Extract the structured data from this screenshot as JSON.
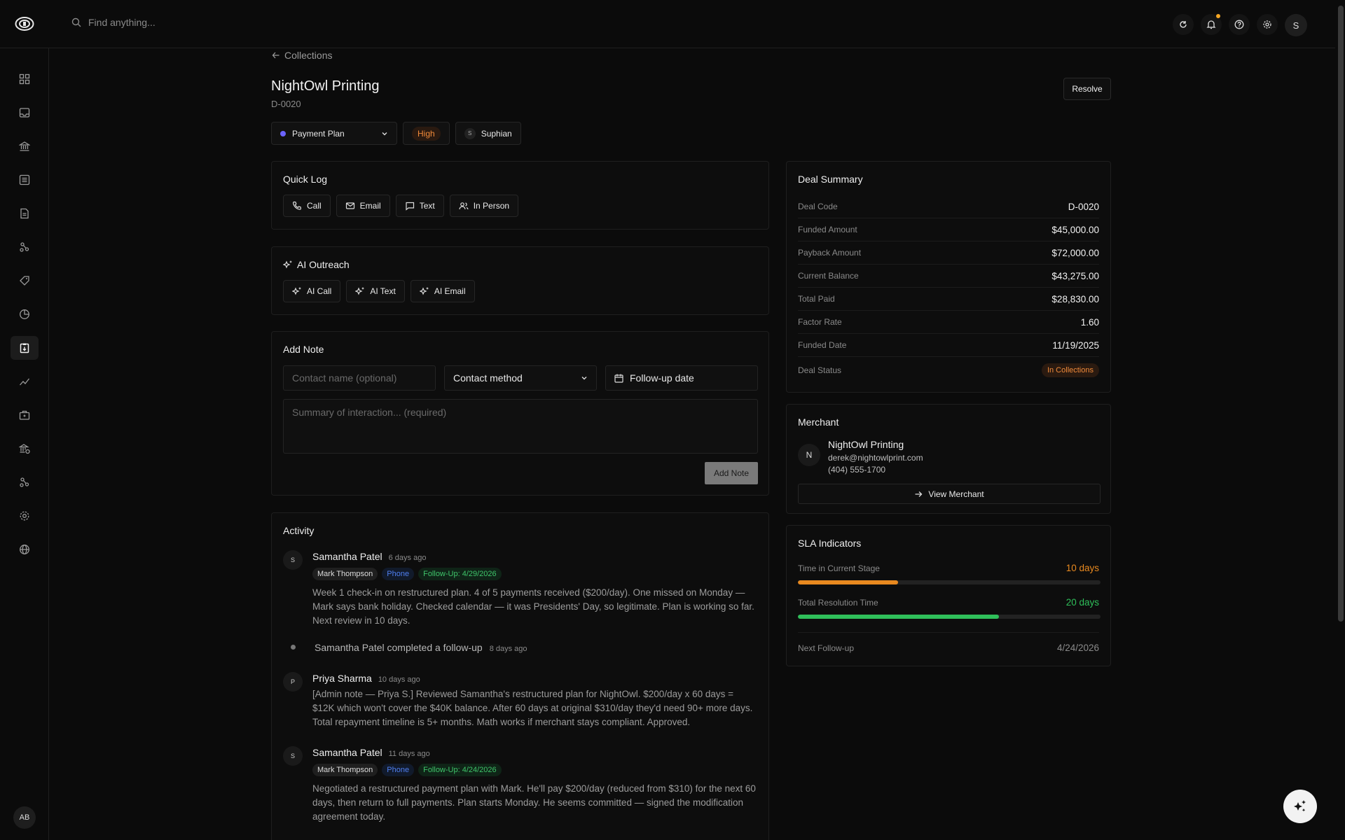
{
  "topbar": {
    "search_placeholder": "Find anything...",
    "avatar": "S",
    "icons": [
      "refresh-icon",
      "bell-icon",
      "help-icon",
      "settings-icon"
    ],
    "notification_color": "#f5a623"
  },
  "sidebar": {
    "items": [
      "dashboard-icon",
      "inbox-icon",
      "bank-icon",
      "list-icon",
      "document-icon",
      "nodes-icon",
      "tag-icon",
      "pie-icon",
      "collections-icon",
      "trend-icon",
      "briefcase-icon",
      "lender-icon",
      "workflow-icon",
      "settings-icon",
      "globe-icon"
    ],
    "active": "collections-icon",
    "user_initials": "AB"
  },
  "header": {
    "back_label": "Collections",
    "title": "NightOwl Printing",
    "deal_id": "D-0020",
    "resolve_label": "Resolve",
    "status": "Payment Plan",
    "status_color": "#6b63ff",
    "priority": "High",
    "assignee": "Suphian",
    "assignee_initial": "S"
  },
  "quick_log": {
    "title": "Quick Log",
    "buttons": [
      "Call",
      "Email",
      "Text",
      "In Person"
    ]
  },
  "ai_outreach": {
    "title": "AI Outreach",
    "buttons": [
      "AI Call",
      "AI Text",
      "AI Email"
    ]
  },
  "add_note": {
    "title": "Add Note",
    "contact_placeholder": "Contact name (optional)",
    "contact_method": "Contact method",
    "followup": "Follow-up date",
    "summary_placeholder": "Summary of interaction... (required)",
    "submit": "Add Note"
  },
  "activity": {
    "title": "Activity",
    "items": [
      {
        "initial": "S",
        "name": "Samantha Patel",
        "time": "6 days ago",
        "tags": [
          "Mark Thompson",
          "Phone",
          "Follow-Up: 4/29/2026"
        ],
        "body": "Week 1 check-in on restructured plan. 4 of 5 payments received ($200/day). One missed on Monday — Mark says bank holiday. Checked calendar — it was Presidents' Day, so legitimate. Plan is working so far. Next review in 10 days."
      },
      {
        "event": "Samantha Patel completed a follow-up",
        "time": "8 days ago"
      },
      {
        "initial": "P",
        "name": "Priya Sharma",
        "time": "10 days ago",
        "body": "[Admin note — Priya S.] Reviewed Samantha's restructured plan for NightOwl. $200/day x 60 days = $12K which won't cover the $40K balance. After 60 days at original $310/day they'd need 90+ more days. Total repayment timeline is 5+ months. Math works if merchant stays compliant. Approved."
      },
      {
        "initial": "S",
        "name": "Samantha Patel",
        "time": "11 days ago",
        "tags": [
          "Mark Thompson",
          "Phone",
          "Follow-Up: 4/24/2026"
        ],
        "body": "Negotiated a restructured payment plan with Mark. He'll pay $200/day (reduced from $310) for the next 60 days, then return to full payments. Plan starts Monday. He seems committed — signed the modification agreement today."
      }
    ]
  },
  "deal_summary": {
    "title": "Deal Summary",
    "rows": [
      {
        "k": "Deal Code",
        "v": "D-0020"
      },
      {
        "k": "Funded Amount",
        "v": "$45,000.00"
      },
      {
        "k": "Payback Amount",
        "v": "$72,000.00"
      },
      {
        "k": "Current Balance",
        "v": "$43,275.00"
      },
      {
        "k": "Total Paid",
        "v": "$28,830.00"
      },
      {
        "k": "Factor Rate",
        "v": "1.60"
      },
      {
        "k": "Funded Date",
        "v": "11/19/2025"
      }
    ],
    "status_label": "Deal Status",
    "status_value": "In Collections"
  },
  "merchant": {
    "title": "Merchant",
    "initial": "N",
    "name": "NightOwl Printing",
    "email": "derek@nightowlprint.com",
    "phone": "(404) 555-1700",
    "view_label": "View Merchant"
  },
  "sla": {
    "title": "SLA Indicators",
    "stage_label": "Time in Current Stage",
    "stage_value": "10 days",
    "stage_fraction": 0.33,
    "stage_color": "#e8891f",
    "resolution_label": "Total Resolution Time",
    "resolution_value": "20 days",
    "resolution_fraction": 0.665,
    "resolution_color": "#2fbf5a",
    "next_label": "Next Follow-up",
    "next_value": "4/24/2026"
  }
}
